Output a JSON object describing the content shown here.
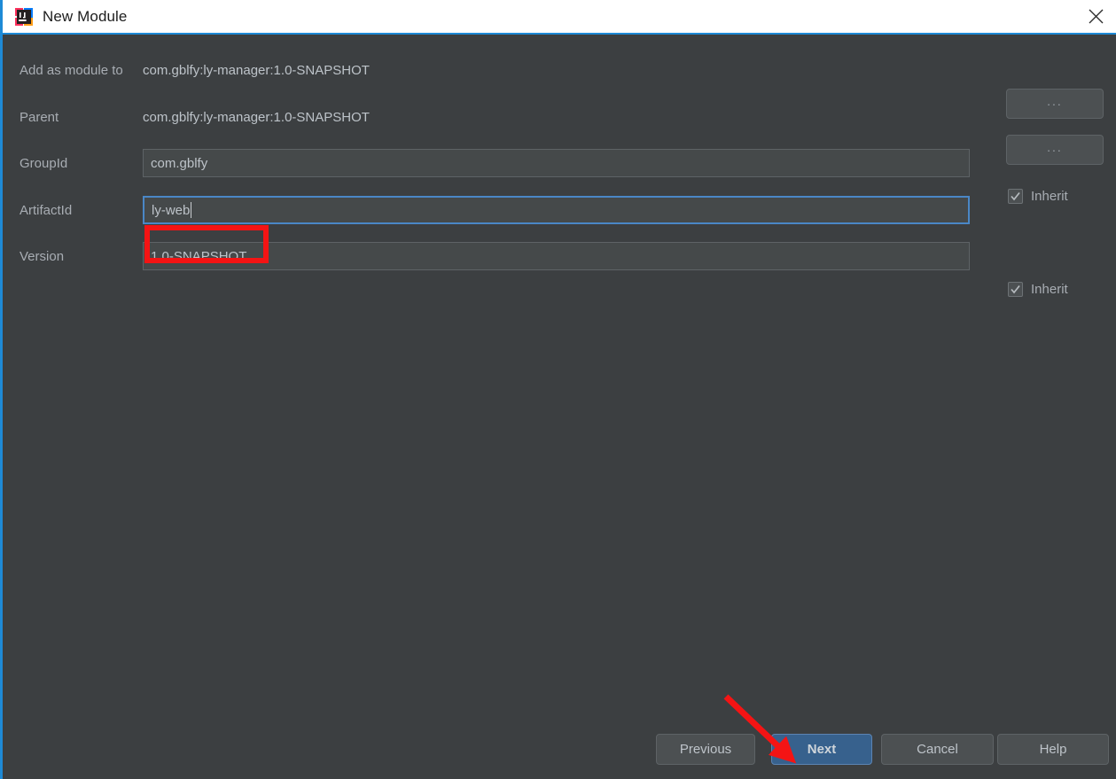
{
  "window": {
    "title": "New Module",
    "logo_icon": "intellij-idea-logo",
    "close_icon": "close-icon",
    "accent_color": "#1e8ad6",
    "background_color": "#3c3f41"
  },
  "form": {
    "rows": [
      {
        "label": "Add as module to",
        "type": "static",
        "value": "com.gblfy:ly-manager:1.0-SNAPSHOT"
      },
      {
        "label": "Parent",
        "type": "static",
        "value": "com.gblfy:ly-manager:1.0-SNAPSHOT"
      },
      {
        "label": "GroupId",
        "type": "input",
        "value": "com.gblfy",
        "focused": false
      },
      {
        "label": "ArtifactId",
        "type": "input",
        "value": "ly-web",
        "focused": true
      },
      {
        "label": "Version",
        "type": "input",
        "value": "1.0-SNAPSHOT",
        "focused": false
      }
    ],
    "browse_buttons": [
      {
        "label": "...",
        "name": "add-as-module-to-browse-button"
      },
      {
        "label": "...",
        "name": "parent-browse-button"
      }
    ],
    "inherit_checkboxes": [
      {
        "label": "Inherit",
        "checked": true,
        "name": "groupid-inherit-checkbox"
      },
      {
        "label": "Inherit",
        "checked": true,
        "name": "version-inherit-checkbox"
      }
    ]
  },
  "footer": {
    "previous_label": "Previous",
    "next_label": "Next",
    "cancel_label": "Cancel",
    "help_label": "Help",
    "default_button": "Next",
    "next_button_color": "#37618d"
  },
  "annotations": {
    "highlight_box": {
      "name": "artifactid-highlight-box",
      "color": "#f41414"
    },
    "arrow": {
      "name": "next-button-arrow",
      "color": "#f41414",
      "points_to": "Next"
    }
  }
}
